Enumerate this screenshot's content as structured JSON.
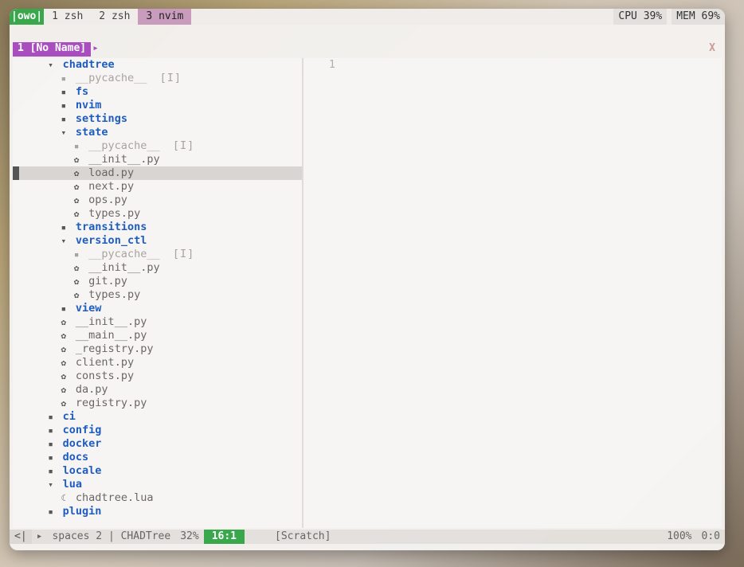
{
  "tmux": {
    "session": "|owo|",
    "tabs": [
      {
        "index": "1",
        "name": "zsh",
        "active": false
      },
      {
        "index": "2",
        "name": "zsh",
        "active": false
      },
      {
        "index": "3",
        "name": "nvim",
        "active": true
      }
    ],
    "cpu_label": "CPU",
    "cpu_value": "39%",
    "mem_label": "MEM",
    "mem_value": "69%"
  },
  "tabline": {
    "tab": "1 [No Name]",
    "sep": "▸",
    "close": "X"
  },
  "tree": {
    "items": [
      {
        "depth": 2,
        "kind": "dir-open",
        "name": "chadtree",
        "selected": false
      },
      {
        "depth": 3,
        "kind": "dir",
        "name": "__pycache__",
        "muted": true,
        "tag": "[I]"
      },
      {
        "depth": 3,
        "kind": "dir",
        "name": "fs"
      },
      {
        "depth": 3,
        "kind": "dir",
        "name": "nvim"
      },
      {
        "depth": 3,
        "kind": "dir",
        "name": "settings"
      },
      {
        "depth": 3,
        "kind": "dir-open",
        "name": "state"
      },
      {
        "depth": 4,
        "kind": "dir",
        "name": "__pycache__",
        "muted": true,
        "tag": "[I]"
      },
      {
        "depth": 4,
        "kind": "py",
        "name": "__init__.py"
      },
      {
        "depth": 4,
        "kind": "py",
        "name": "load.py",
        "selected": true
      },
      {
        "depth": 4,
        "kind": "py",
        "name": "next.py"
      },
      {
        "depth": 4,
        "kind": "py",
        "name": "ops.py"
      },
      {
        "depth": 4,
        "kind": "py",
        "name": "types.py"
      },
      {
        "depth": 3,
        "kind": "dir",
        "name": "transitions"
      },
      {
        "depth": 3,
        "kind": "dir-open",
        "name": "version_ctl"
      },
      {
        "depth": 4,
        "kind": "dir",
        "name": "__pycache__",
        "muted": true,
        "tag": "[I]"
      },
      {
        "depth": 4,
        "kind": "py",
        "name": "__init__.py"
      },
      {
        "depth": 4,
        "kind": "py",
        "name": "git.py"
      },
      {
        "depth": 4,
        "kind": "py",
        "name": "types.py"
      },
      {
        "depth": 3,
        "kind": "dir",
        "name": "view"
      },
      {
        "depth": 3,
        "kind": "py",
        "name": "__init__.py"
      },
      {
        "depth": 3,
        "kind": "py",
        "name": "__main__.py"
      },
      {
        "depth": 3,
        "kind": "py",
        "name": "_registry.py"
      },
      {
        "depth": 3,
        "kind": "py",
        "name": "client.py"
      },
      {
        "depth": 3,
        "kind": "py",
        "name": "consts.py"
      },
      {
        "depth": 3,
        "kind": "py",
        "name": "da.py"
      },
      {
        "depth": 3,
        "kind": "py",
        "name": "registry.py"
      },
      {
        "depth": 2,
        "kind": "dir",
        "name": "ci"
      },
      {
        "depth": 2,
        "kind": "dir",
        "name": "config"
      },
      {
        "depth": 2,
        "kind": "dir",
        "name": "docker"
      },
      {
        "depth": 2,
        "kind": "dir",
        "name": "docs"
      },
      {
        "depth": 2,
        "kind": "dir",
        "name": "locale"
      },
      {
        "depth": 2,
        "kind": "dir-open",
        "name": "lua"
      },
      {
        "depth": 3,
        "kind": "lua",
        "name": "chadtree.lua"
      },
      {
        "depth": 2,
        "kind": "dir",
        "name": "plugin"
      }
    ]
  },
  "editor": {
    "line_number": "1"
  },
  "statusline": {
    "mode": "<|",
    "sep": "▸",
    "spaces": "spaces 2",
    "pipe": "|",
    "name": "CHADTree",
    "percent_left": "32%",
    "pos": "16:1",
    "scratch": "[Scratch]",
    "percent_right": "100%",
    "pos_right": "0:0"
  }
}
